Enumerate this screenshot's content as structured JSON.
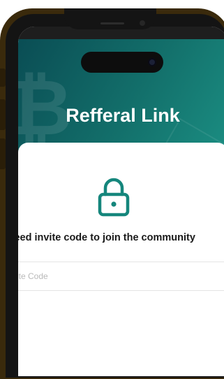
{
  "header": {
    "title": "Refferal Link"
  },
  "invite": {
    "prompt": "Need invite code to join the community",
    "placeholder": "Invite Code"
  },
  "colors": {
    "accent": "#13706b",
    "frame": "#3a2a0c"
  },
  "icons": {
    "lock": "lock-icon",
    "bitcoin": "bitcoin-icon"
  }
}
